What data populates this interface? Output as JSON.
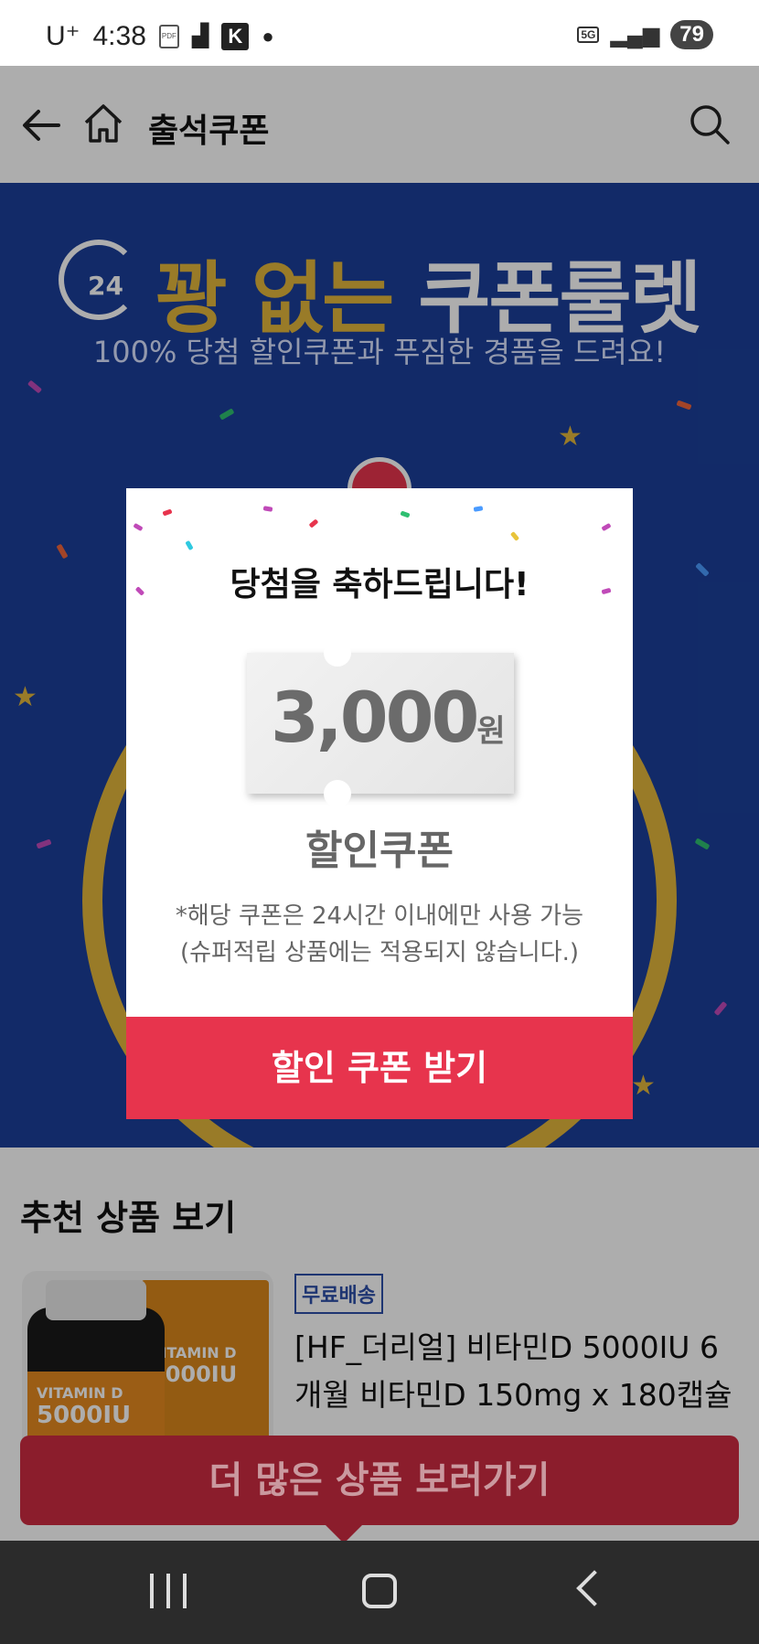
{
  "status_bar": {
    "carrier": "U⁺",
    "time": "4:38",
    "network": "5G",
    "battery": "79"
  },
  "header": {
    "title": "출석쿠폰",
    "back_icon": "back-arrow-icon",
    "home_icon": "home-icon",
    "search_icon": "search-icon"
  },
  "banner": {
    "clock_label": "24",
    "title_gold": "꽝 없는",
    "title_white": "쿠폰룰렛",
    "subtitle": "100% 당첨 할인쿠폰과 푸짐한 경품을 드려요!"
  },
  "modal": {
    "title": "당첨을 축하드립니다!",
    "amount": "3,000",
    "currency": "원",
    "label": "할인쿠폰",
    "note_line1": "*해당 쿠폰은 24시간 이내에만 사용 가능",
    "note_line2": "(슈퍼적립 상품에는 적용되지 않습니다.)",
    "button": "할인 쿠폰 받기"
  },
  "recommend": {
    "title": "추천 상품 보기",
    "badge": "무료배송",
    "product_name": "[HF_더리얼] 비타민D 5000IU 6개월 비타민D 150mg x 180캡슐",
    "product_label_small": "VITAMIN D",
    "product_label_dose": "5000IU"
  },
  "bottom_cta": {
    "label": "더 많은 상품 보러가기"
  },
  "colors": {
    "banner_blue": "#1b3f9a",
    "gold": "#e2b53b",
    "accent_red": "#e7344d",
    "cta_dark_red": "#8b1d2c"
  }
}
